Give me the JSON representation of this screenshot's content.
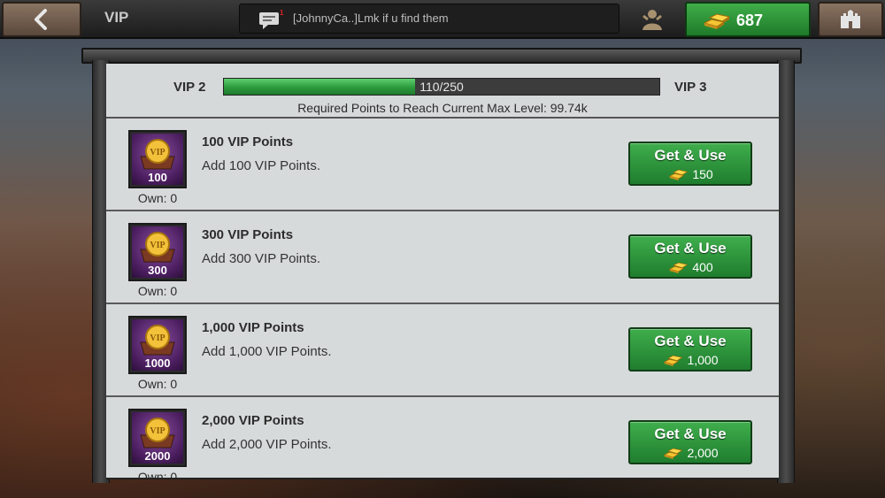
{
  "header": {
    "title": "VIP",
    "chat_message": "[JohnnyCa..]Lmk if u find them",
    "gold_amount": "687"
  },
  "vip": {
    "current_level": "VIP 2",
    "next_level": "VIP 3",
    "progress_text": "110/250",
    "progress_fraction": 0.44,
    "required_text": "Required Points to Reach Current Max Level: 99.74k"
  },
  "items": [
    {
      "badge": "100",
      "name": "100 VIP Points",
      "desc": "Add 100 VIP Points.",
      "own": "Own: 0",
      "button": "Get & Use",
      "cost": "150"
    },
    {
      "badge": "300",
      "name": "300 VIP Points",
      "desc": "Add 300 VIP Points.",
      "own": "Own: 0",
      "button": "Get & Use",
      "cost": "400"
    },
    {
      "badge": "1000",
      "name": "1,000 VIP Points",
      "desc": "Add 1,000 VIP Points.",
      "own": "Own: 0",
      "button": "Get & Use",
      "cost": "1,000"
    },
    {
      "badge": "2000",
      "name": "2,000 VIP Points",
      "desc": "Add 2,000 VIP Points.",
      "own": "Own: 0",
      "button": "Get & Use",
      "cost": "2,000"
    }
  ],
  "icons": {
    "back": "arrow-left-icon",
    "chat": "chat-bubble-icon",
    "friend": "friend-icon",
    "gold": "gold-bars-icon",
    "castle": "castle-icon",
    "vip_coin": "vip-coin-chest-icon"
  },
  "colors": {
    "accent_green": "#2c9a3c",
    "badge_purple": "#4a1d5e"
  }
}
